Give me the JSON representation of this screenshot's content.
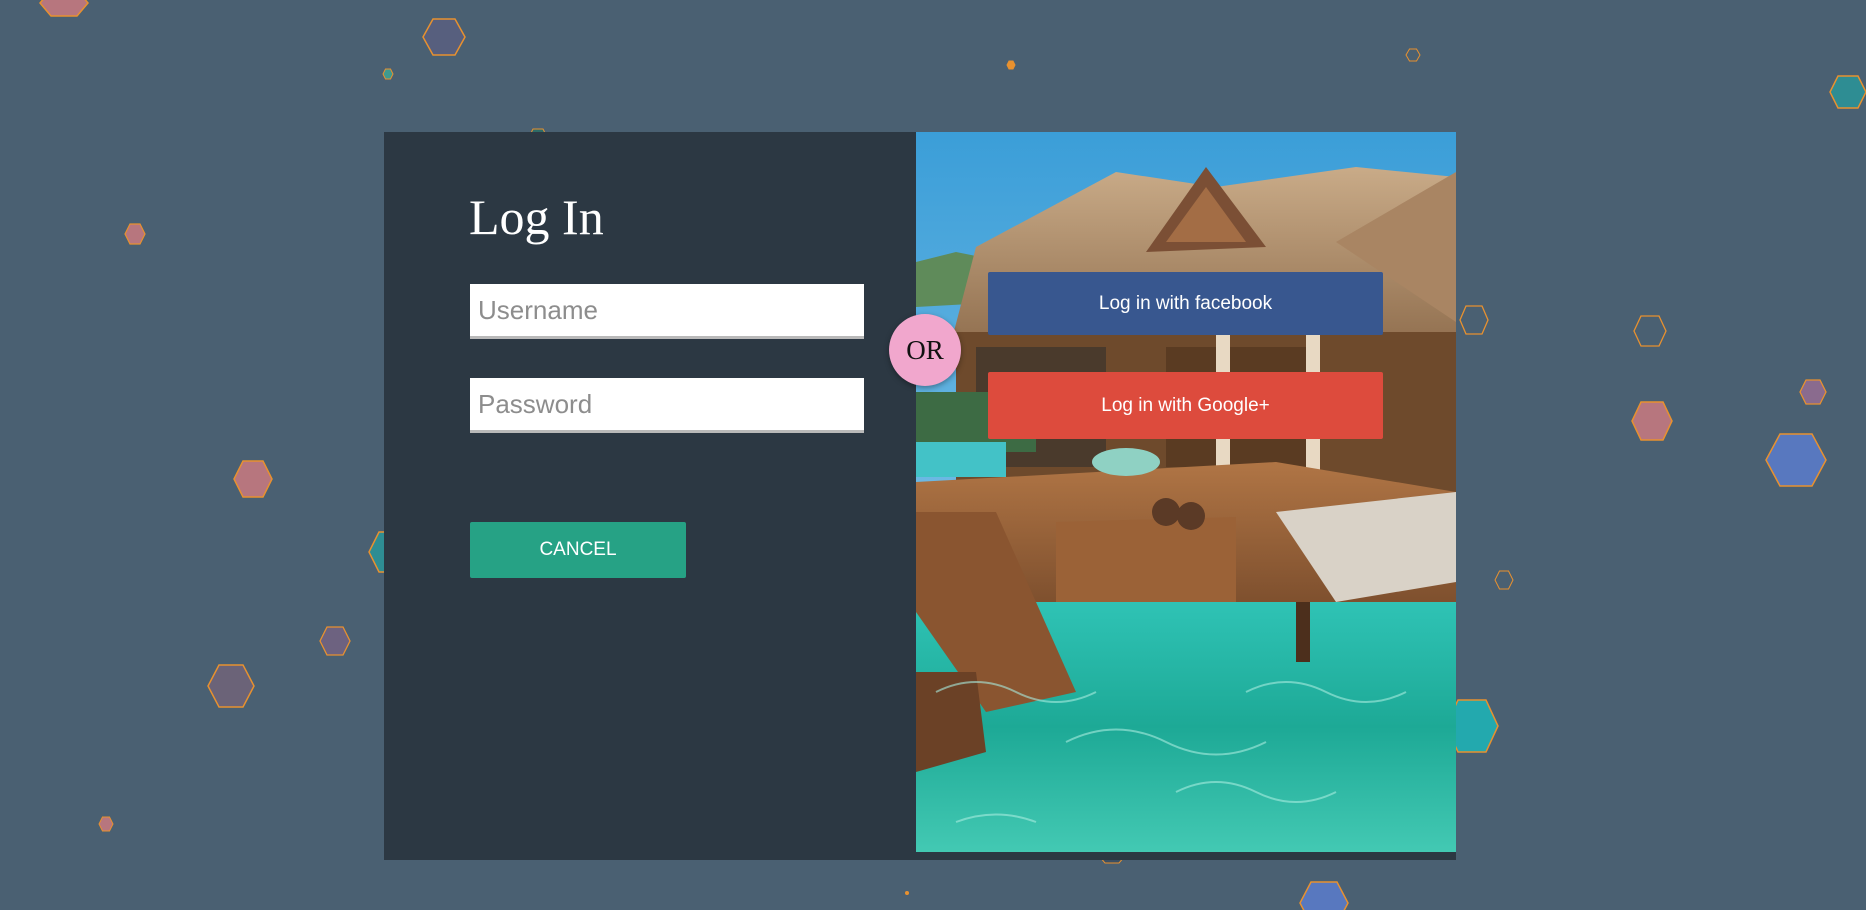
{
  "login": {
    "title": "Log In",
    "username_placeholder": "Username",
    "password_placeholder": "Password",
    "cancel_label": "CANCEL"
  },
  "divider": {
    "label": "OR"
  },
  "social": {
    "facebook_label": "Log in with facebook",
    "google_label": "Log in with Google+"
  },
  "colors": {
    "page_background": "#4a6072",
    "panel_background": "#2c3843",
    "cancel_button": "#26a285",
    "facebook_button": "#38578f",
    "google_button": "#dd4b3d",
    "or_badge": "#f1a7cd",
    "hexagon_outline": "#e8912f"
  }
}
